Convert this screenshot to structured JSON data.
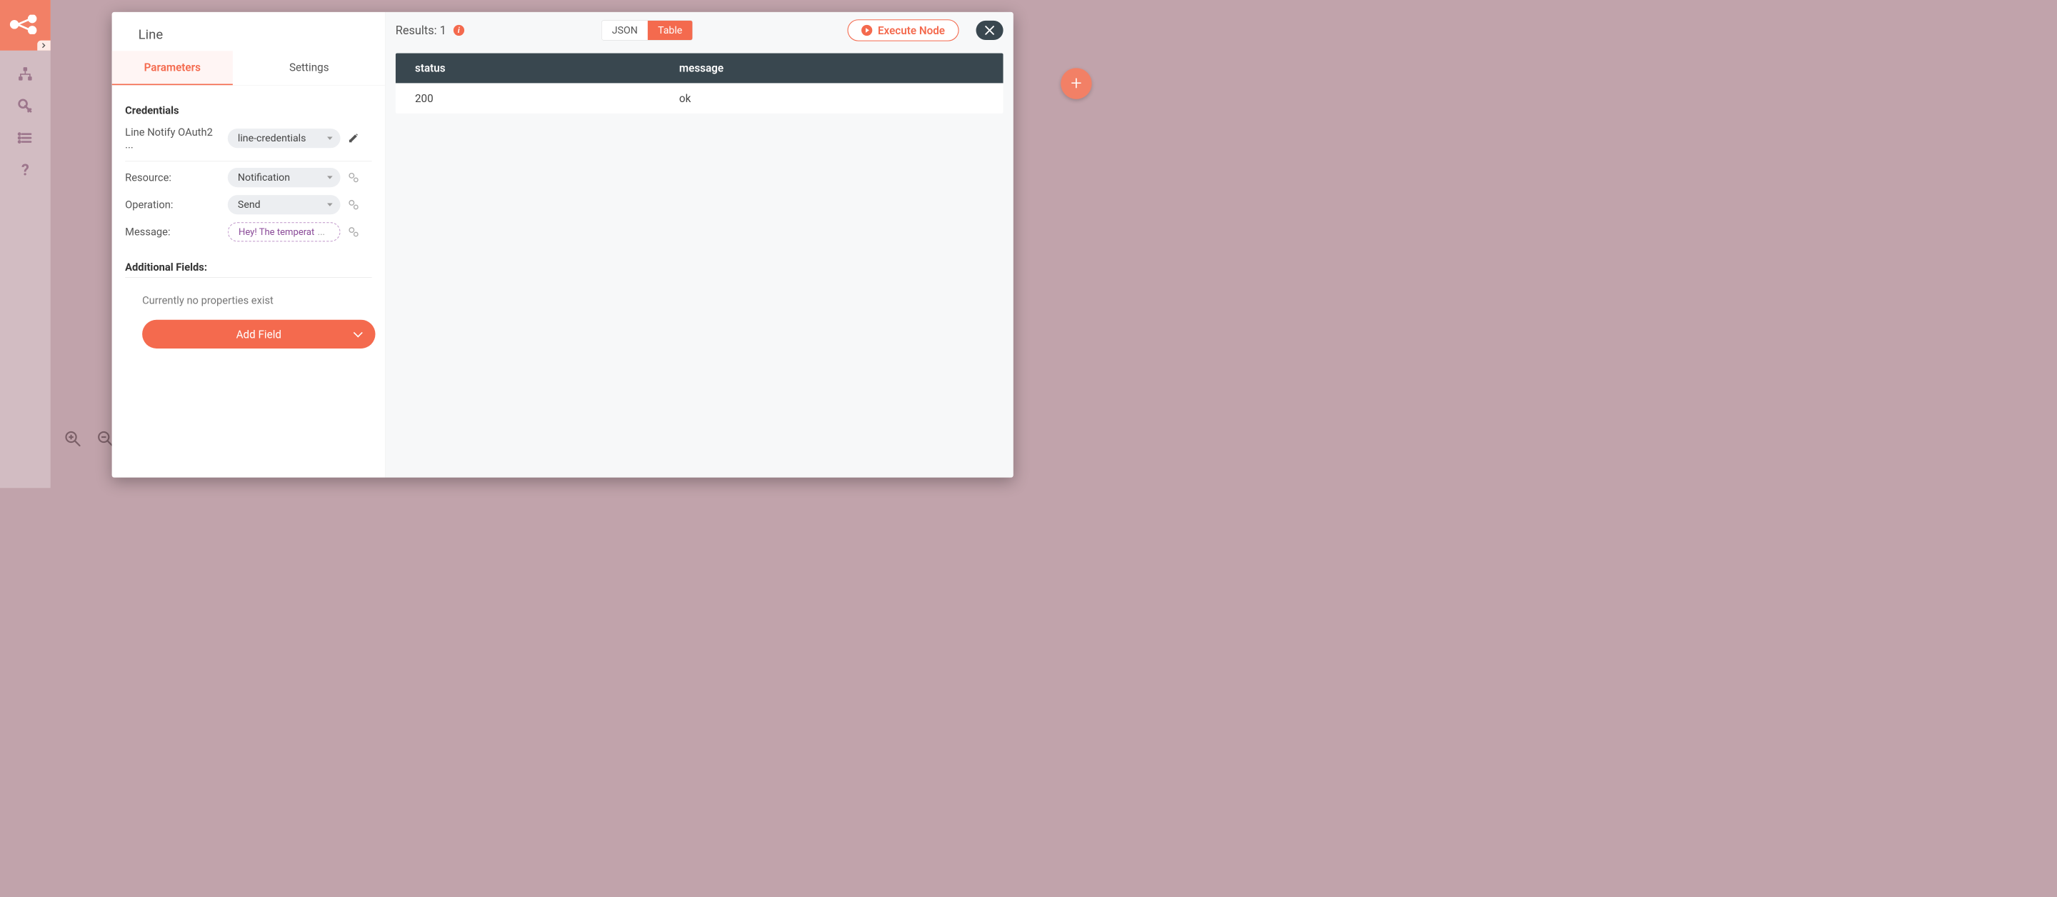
{
  "sidebar": {
    "icons": [
      "workflows-icon",
      "credentials-icon",
      "executions-icon",
      "help-icon"
    ]
  },
  "modal": {
    "title": "Line",
    "tabs": {
      "parameters": "Parameters",
      "settings": "Settings"
    },
    "credentials": {
      "heading": "Credentials",
      "label": "Line Notify OAuth2 ...",
      "selected": "line-credentials"
    },
    "params": {
      "resource": {
        "label": "Resource:",
        "value": "Notification"
      },
      "operation": {
        "label": "Operation:",
        "value": "Send"
      },
      "message": {
        "label": "Message:",
        "value": "Hey! The temperat",
        "truncation": "..."
      }
    },
    "additional": {
      "heading": "Additional Fields:",
      "empty": "Currently no properties exist",
      "addBtn": "Add Field"
    },
    "results": {
      "label": "Results: 1",
      "viewJSON": "JSON",
      "viewTable": "Table",
      "executeBtn": "Execute Node",
      "columns": [
        "status",
        "message"
      ],
      "rows": [
        {
          "status": "200",
          "message": "ok"
        }
      ]
    }
  },
  "colors": {
    "accent": "#f46a4e",
    "tableHeader": "#39474F"
  }
}
